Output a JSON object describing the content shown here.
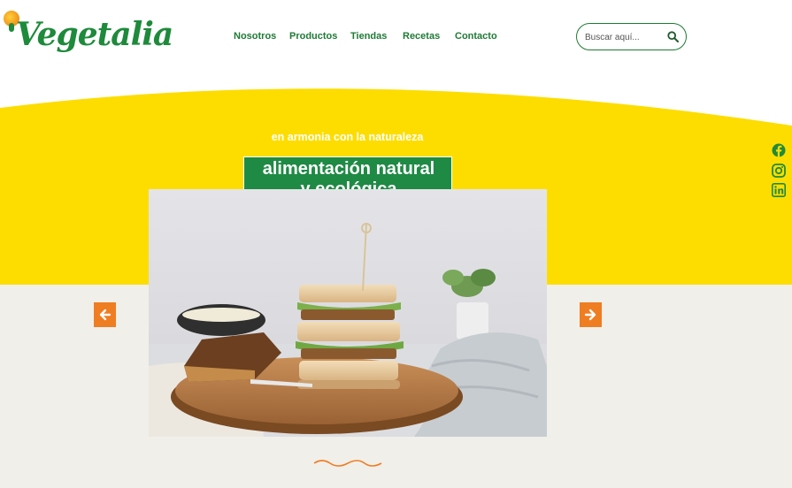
{
  "brand": {
    "logo_text": "Vegetalia",
    "green": "#1e8a3b",
    "yellow": "#fddd00",
    "orange": "#ef7d22",
    "beige": "#f1efea"
  },
  "nav": {
    "items": [
      {
        "label": "Nosotros"
      },
      {
        "label": "Productos"
      },
      {
        "label": "Tiendas"
      },
      {
        "label": "Recetas"
      },
      {
        "label": "Contacto"
      }
    ]
  },
  "search": {
    "placeholder": "Buscar aquí...",
    "icon": "search-icon"
  },
  "social": {
    "icons": [
      "facebook-icon",
      "instagram-icon",
      "linkedin-icon"
    ]
  },
  "hero": {
    "tagline": "en armonia con la naturaleza",
    "headline_line1": "alimentación natural",
    "headline_line2": "y ecológica",
    "image": "sandwich-photo",
    "prev_icon": "arrow-left-icon",
    "next_icon": "arrow-right-icon"
  }
}
